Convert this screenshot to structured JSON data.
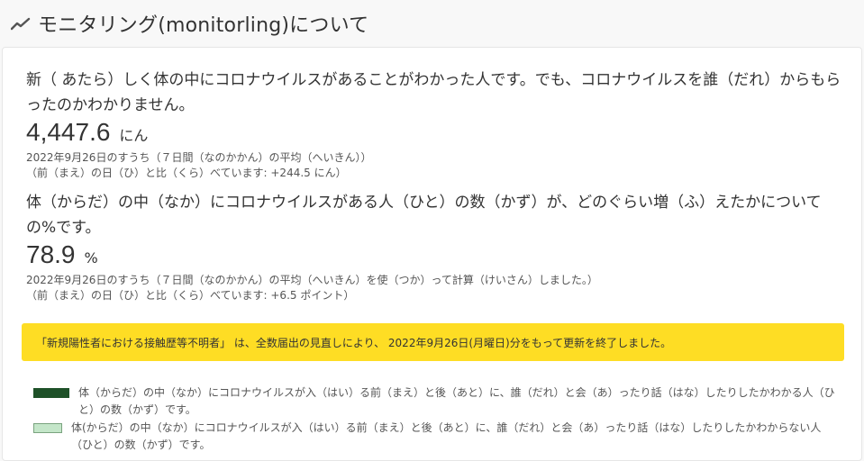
{
  "header": {
    "title": "モニタリング(monitorling)について",
    "icon": "trend-line-icon"
  },
  "metric1": {
    "description": "新（ あたら）しく体の中にコロナウイルスがあることがわかった人です。でも、コロナウイルスを誰（だれ）からもらったのかわかりません。",
    "value": "4,447.6",
    "unit": "にん",
    "note_date": "2022年9月26日のすうち（７日間（なのかかん）の平均（へいきん））",
    "note_compare": "（前（まえ）の日（ひ）と比（くら）べています: +244.5 にん）"
  },
  "metric2": {
    "description": "体（からだ）の中（なか）にコロナウイルスがある人（ひと）の数（かず）が、どのぐらい増（ふ）えたかについての%です。",
    "value": "78.9",
    "unit": "%",
    "note_date": "2022年9月26日のすうち（７日間（なのかかん）の平均（へいきん）を使（つか）って計算（けいさん）しました。）",
    "note_compare": "（前（まえ）の日（ひ）と比（くら）べています: +6.5 ポイント）"
  },
  "notice": {
    "text": "「新規陽性者における接触歴等不明者」 は、全数届出の見直しにより、 2022年9月26日(月曜日)分をもって更新を終了しました。",
    "color": "#fedd24"
  },
  "legend": {
    "items": [
      {
        "label": "体（からだ）の中（なか）にコロナウイルスが入（はい）る前（まえ）と後（あと）に、誰（だれ）と会（あ）ったり話（はな）したりしたかわかる人（ひと）の数（かず）です。",
        "color": "#1e5128"
      },
      {
        "label": "体(からだ）の中（なか）にコロナウイルスが入（はい）る前（まえ）と後（あと）に、誰（だれ）と会（あ）ったり話（はな）したりしたかわからない人（ひと）の数（かず）です。",
        "color": "#c4e6c9"
      }
    ]
  }
}
